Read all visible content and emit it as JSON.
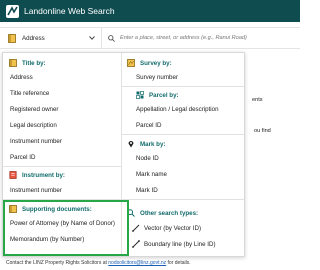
{
  "header": {
    "title": "Landonline Web Search"
  },
  "search": {
    "type_label": "Address",
    "placeholder": "Enter a place, street, or address (e.g., Ranui Road)"
  },
  "background": {
    "fragment_1": "ents",
    "fragment_2": "ou find",
    "footer_prefix": "Contact the LINZ Property Rights Solicitors at",
    "footer_link": "nodsolicitors@linz.govt.nz",
    "footer_suffix": "for details."
  },
  "menu": {
    "title_group": {
      "heading": "Title by:",
      "items": [
        "Address",
        "Title reference",
        "Registered owner",
        "Legal description",
        "Instrument number",
        "Parcel ID"
      ]
    },
    "instrument_group": {
      "heading": "Instrument by:",
      "items": [
        "Instrument number"
      ]
    },
    "supporting_group": {
      "heading": "Supporting documents:",
      "items": [
        "Power of Attorney (by Name of Donor)",
        "Memorandum (by Number)"
      ]
    },
    "survey_group": {
      "heading": "Survey by:",
      "items": [
        "Survey number"
      ]
    },
    "parcel_group": {
      "heading": "Parcel by:",
      "items": [
        "Appellation / Legal description",
        "Parcel ID"
      ]
    },
    "mark_group": {
      "heading": "Mark by:",
      "items": [
        "Node ID",
        "Mark name",
        "Mark ID"
      ]
    },
    "other_group": {
      "heading": "Other search types:",
      "items": [
        "Vector (by Vector ID)",
        "Boundary line (by Line ID)"
      ]
    }
  },
  "colors": {
    "header_bg": "#0f4c50",
    "group_heading": "#116b6b",
    "highlight_border": "#27a745"
  }
}
